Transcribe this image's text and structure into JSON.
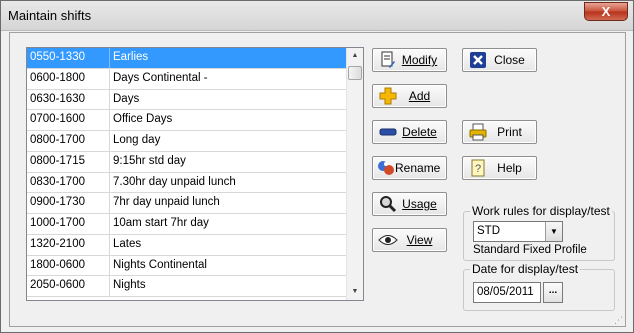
{
  "window": {
    "title": "Maintain shifts",
    "close_glyph": "X"
  },
  "shifts": [
    {
      "code": "0550-1330",
      "name": "Earlies",
      "selected": true
    },
    {
      "code": "0600-1800",
      "name": "Days Continental -"
    },
    {
      "code": "0630-1630",
      "name": "Days"
    },
    {
      "code": "0700-1600",
      "name": "Office Days"
    },
    {
      "code": "0800-1700",
      "name": "Long day"
    },
    {
      "code": "0800-1715",
      "name": "9:15hr std day"
    },
    {
      "code": "0830-1700",
      "name": "7.30hr day unpaid lunch"
    },
    {
      "code": "0900-1730",
      "name": "7hr day unpaid lunch"
    },
    {
      "code": "1000-1700",
      "name": "10am start 7hr day"
    },
    {
      "code": "1320-2100",
      "name": "Lates"
    },
    {
      "code": "1800-0600",
      "name": "Nights Continental"
    },
    {
      "code": "2050-0600",
      "name": "Nights"
    }
  ],
  "buttons": {
    "modify": {
      "label": "Modify",
      "icon": "document-edit-icon"
    },
    "add": {
      "label": "Add",
      "icon": "plus-icon"
    },
    "delete": {
      "label": "Delete",
      "icon": "minus-icon"
    },
    "rename": {
      "label": "Rename",
      "icon": "rename-icon"
    },
    "usage": {
      "label": "Usage",
      "icon": "magnifier-icon"
    },
    "view": {
      "label": "View",
      "icon": "eye-icon"
    },
    "close": {
      "label": "Close",
      "icon": "close-dialog-icon"
    },
    "print": {
      "label": "Print",
      "icon": "printer-icon"
    },
    "help": {
      "label": "Help",
      "icon": "help-book-icon"
    }
  },
  "work_rules": {
    "legend": "Work rules for display/test",
    "selected": "STD",
    "description": "Standard Fixed Profile"
  },
  "date_group": {
    "legend": "Date for display/test",
    "value": "08/05/2011",
    "picker_label": "..."
  },
  "colors": {
    "selection": "#3399ff",
    "window_bg": "#f0f0f0",
    "close_button": "#c75038"
  }
}
